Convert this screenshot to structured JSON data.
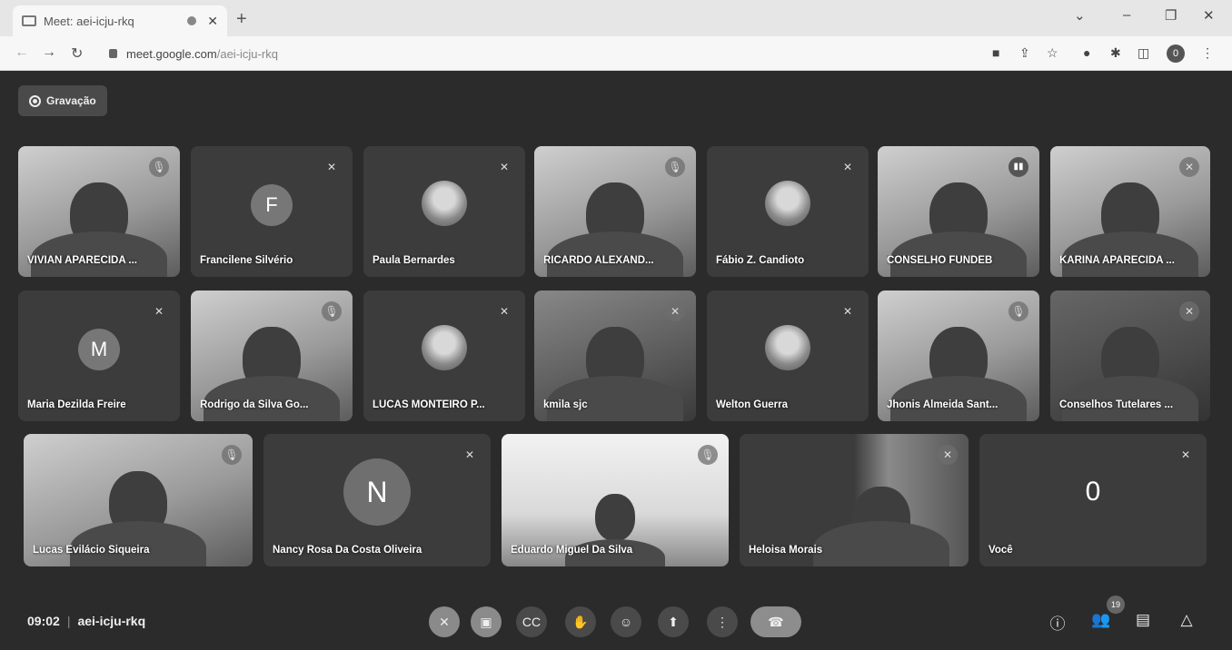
{
  "browser": {
    "tab_title": "Meet: aei-icju-rkq",
    "url_host": "meet.google.com",
    "url_path": "/aei-icju-rkq",
    "profile_initial": "0"
  },
  "recording": {
    "label": "Gravação"
  },
  "participants": [
    {
      "name": "VIVIAN APARECIDA ..."
    },
    {
      "name": "Francilene Silvério",
      "initial": "F"
    },
    {
      "name": "Paula Bernardes"
    },
    {
      "name": "RICARDO ALEXAND..."
    },
    {
      "name": "Fábio Z. Candioto"
    },
    {
      "name": "CONSELHO FUNDEB"
    },
    {
      "name": "KARINA APARECIDA ..."
    },
    {
      "name": "Maria Dezilda Freire",
      "initial": "M"
    },
    {
      "name": "Rodrigo da Silva Go..."
    },
    {
      "name": "LUCAS MONTEIRO P..."
    },
    {
      "name": "kmila sjc"
    },
    {
      "name": "Welton Guerra"
    },
    {
      "name": "Jhonis Almeida Sant..."
    },
    {
      "name": "Conselhos Tutelares ..."
    },
    {
      "name": "Lucas Evilácio Siqueira"
    },
    {
      "name": "Nancy Rosa Da Costa Oliveira",
      "initial": "N"
    },
    {
      "name": "Eduardo Miguel Da Silva"
    },
    {
      "name": "Heloisa Morais"
    },
    {
      "name": "Você",
      "initial": "0"
    }
  ],
  "meeting": {
    "time": "09:02",
    "code": "aei-icju-rkq",
    "people_count": "19"
  },
  "colors": {
    "meet_bg": "#2b2b2b",
    "tile_bg": "#3c3c3c"
  }
}
